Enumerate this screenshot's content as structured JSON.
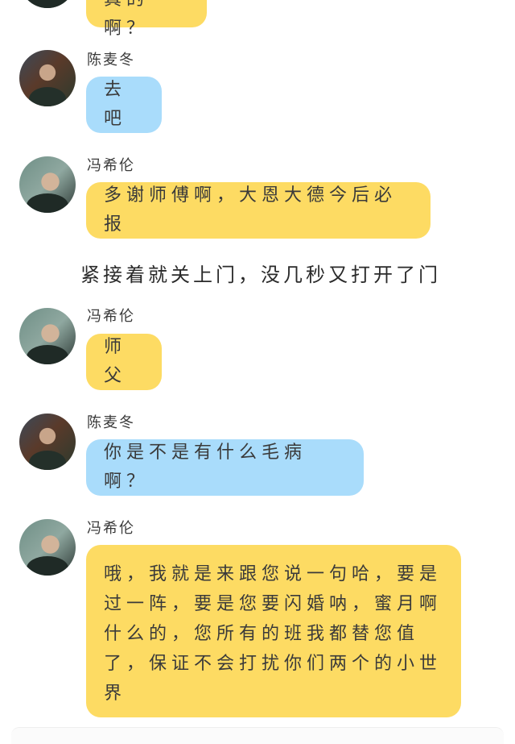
{
  "messages": [
    {
      "speaker": "",
      "text": "真的啊？",
      "color": "yellow",
      "avatar": "feng-avatar"
    },
    {
      "speaker": "陈麦冬",
      "text": "去吧",
      "color": "blue",
      "avatar": "chen-avatar"
    },
    {
      "speaker": "冯希伦",
      "text": "多谢师傅啊，大恩大德今后必报",
      "color": "yellow",
      "avatar": "feng-avatar"
    },
    {
      "narration": "紧接着就关上门，没几秒又打开了门"
    },
    {
      "speaker": "冯希伦",
      "text": "师父",
      "color": "yellow",
      "avatar": "feng-avatar"
    },
    {
      "speaker": "陈麦冬",
      "text": "你是不是有什么毛病啊？",
      "color": "blue",
      "avatar": "chen-avatar"
    },
    {
      "speaker": "冯希伦",
      "text": "哦，我就是来跟您说一句哈，要是过一阵，要是您要闪婚呐，蜜月啊什么的，您所有的班我都替您值了，保证不会打扰你们两个的小世界",
      "color": "yellow",
      "avatar": "feng-avatar"
    }
  ],
  "colors": {
    "yellow": "#fddb63",
    "blue": "#a9dcfb",
    "text": "#3a3a3a"
  }
}
